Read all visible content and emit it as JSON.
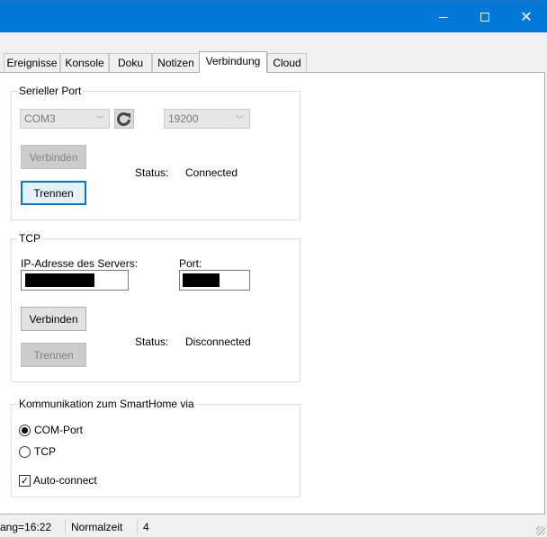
{
  "window": {
    "minimize_icon": "minimize-icon",
    "maximize_icon": "maximize-icon",
    "close_icon": "close-icon",
    "close_glyph": "✕"
  },
  "tabs": [
    {
      "label": "Ereignisse"
    },
    {
      "label": "Konsole"
    },
    {
      "label": "Doku"
    },
    {
      "label": "Notizen"
    },
    {
      "label": "Verbindung",
      "active": true
    },
    {
      "label": "Cloud"
    }
  ],
  "serial": {
    "title": "Serieller Port",
    "port_value": "COM3",
    "baud_value": "19200",
    "refresh_icon": "refresh-icon",
    "connect_label": "Verbinden",
    "disconnect_label": "Trennen",
    "status_label": "Status:",
    "status_value": "Connected"
  },
  "tcp": {
    "title": "TCP",
    "ip_label": "IP-Adresse des Servers:",
    "port_label": "Port:",
    "connect_label": "Verbinden",
    "disconnect_label": "Trennen",
    "status_label": "Status:",
    "status_value": "Disconnected"
  },
  "communication": {
    "title": "Kommunikation zum SmartHome via",
    "option_com": "COM-Port",
    "option_tcp": "TCP",
    "selected": "COM-Port",
    "auto_connect_label": "Auto-connect",
    "auto_connect_checked": true
  },
  "statusbar": {
    "item1": "ang=16:22",
    "item2": "Normalzeit",
    "item3": "4"
  },
  "colors": {
    "titlebar": "#0078d7",
    "focus": "#0078d7"
  }
}
